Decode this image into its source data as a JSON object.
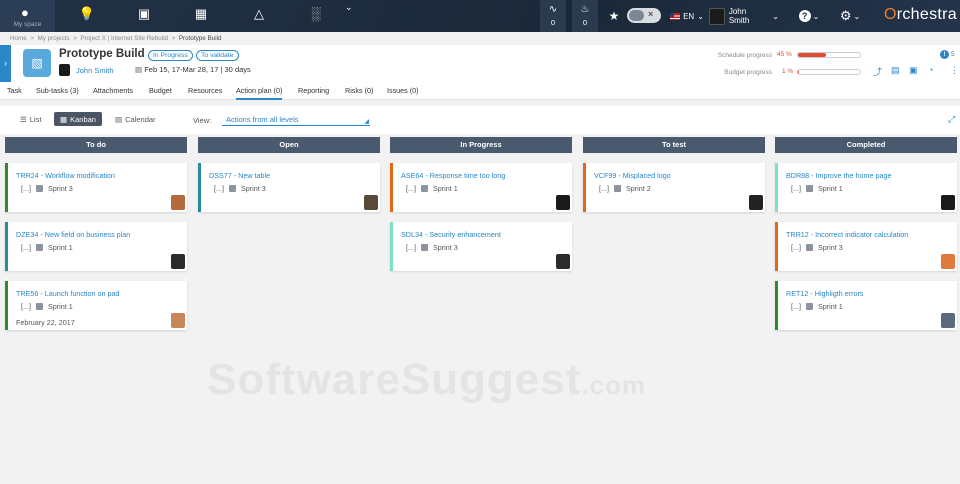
{
  "topbar": {
    "my_space_label": "My space",
    "rss_count": "0",
    "notif_count": "0",
    "language": "EN",
    "user_name": "John Smith",
    "brand_prefix": "O",
    "brand_rest": "rchestra"
  },
  "breadcrumb": {
    "items": [
      "Home",
      "My projects",
      "Project X | Internet Site Rebuild",
      "Prototype Build"
    ],
    "sep": ">"
  },
  "project": {
    "title": "Prototype Build",
    "status_1": "In Progress",
    "status_2": "To validate",
    "owner": "John Smith",
    "dates": "Feb 15, 17-Mar 28, 17 | 30 days",
    "schedule_label": "Schedule progress",
    "schedule_value": "45 %",
    "schedule_fraction": 0.45,
    "budget_label": "Budget progress",
    "budget_value": "1 %",
    "budget_fraction": 0.01,
    "info_count": "5"
  },
  "tabs": [
    "Task",
    "Sub-tasks (3)",
    "Attachments",
    "Budget",
    "Resources",
    "Action plan (0)",
    "Reporting",
    "Risks (0)",
    "Issues (0)"
  ],
  "active_tab": "Action plan (0)",
  "toolbar": {
    "list_label": "List",
    "kanban_label": "Kanban",
    "calendar_label": "Calendar",
    "view_label": "View:",
    "view_value": "Actions from all levels"
  },
  "columns": [
    "To do",
    "Open",
    "In Progress",
    "To test",
    "Completed"
  ],
  "cards": [
    {
      "col": 0,
      "row": 0,
      "title": "TRR24 - Workflow modification",
      "ellipsis": "[...]",
      "sprint": "Sprint 3",
      "color": "#2e8b2e",
      "avatar": "#b46a3c"
    },
    {
      "col": 0,
      "row": 1,
      "title": "DZE34 - New field on business plan",
      "ellipsis": "[...]",
      "sprint": "Sprint 1",
      "color": "#2a8aa0",
      "avatar": "#2b2b2b"
    },
    {
      "col": 0,
      "row": 2,
      "title": "TRE56 - Launch function on pad",
      "ellipsis": "[...]",
      "sprint": "Sprint 1",
      "date": "February 22, 2017",
      "color": "#2e8b2e",
      "avatar": "#c8875a"
    },
    {
      "col": 1,
      "row": 0,
      "title": "DSS77 - New table",
      "ellipsis": "[...]",
      "sprint": "Sprint 3",
      "color": "#2a8aa0",
      "avatar": "#5a4a3a"
    },
    {
      "col": 2,
      "row": 0,
      "title": "ASE64 - Response time too long",
      "ellipsis": "[...]",
      "sprint": "Sprint 1",
      "color": "#e06a1a",
      "avatar": "#1a1a1a"
    },
    {
      "col": 2,
      "row": 1,
      "title": "SDL34 - Security enhancement",
      "ellipsis": "[...]",
      "sprint": "Sprint 3",
      "color": "#7fe0c8",
      "avatar": "#2b2b2b"
    },
    {
      "col": 3,
      "row": 0,
      "title": "VCF99 - Misplaced logo",
      "ellipsis": "[...]",
      "sprint": "Sprint 2",
      "color": "#e06a1a",
      "avatar": "#222222"
    },
    {
      "col": 4,
      "row": 0,
      "title": "BDR88 - Improve the home page",
      "ellipsis": "[...]",
      "sprint": "Sprint 1",
      "color": "#7fe0c8",
      "avatar": "#1a1a1a"
    },
    {
      "col": 4,
      "row": 1,
      "title": "TRR12 - Incorrect indicator calculation",
      "ellipsis": "[...]",
      "sprint": "Sprint 3",
      "color": "#e06a1a",
      "avatar": "#e07a3a"
    },
    {
      "col": 4,
      "row": 2,
      "title": "RET12 - Highligth errors",
      "ellipsis": "[...]",
      "sprint": "Sprint 1",
      "color": "#2e8b2e",
      "avatar": "#5a6a7a"
    }
  ],
  "watermark": {
    "main": "SoftwareSuggest",
    "suffix": ".com"
  }
}
